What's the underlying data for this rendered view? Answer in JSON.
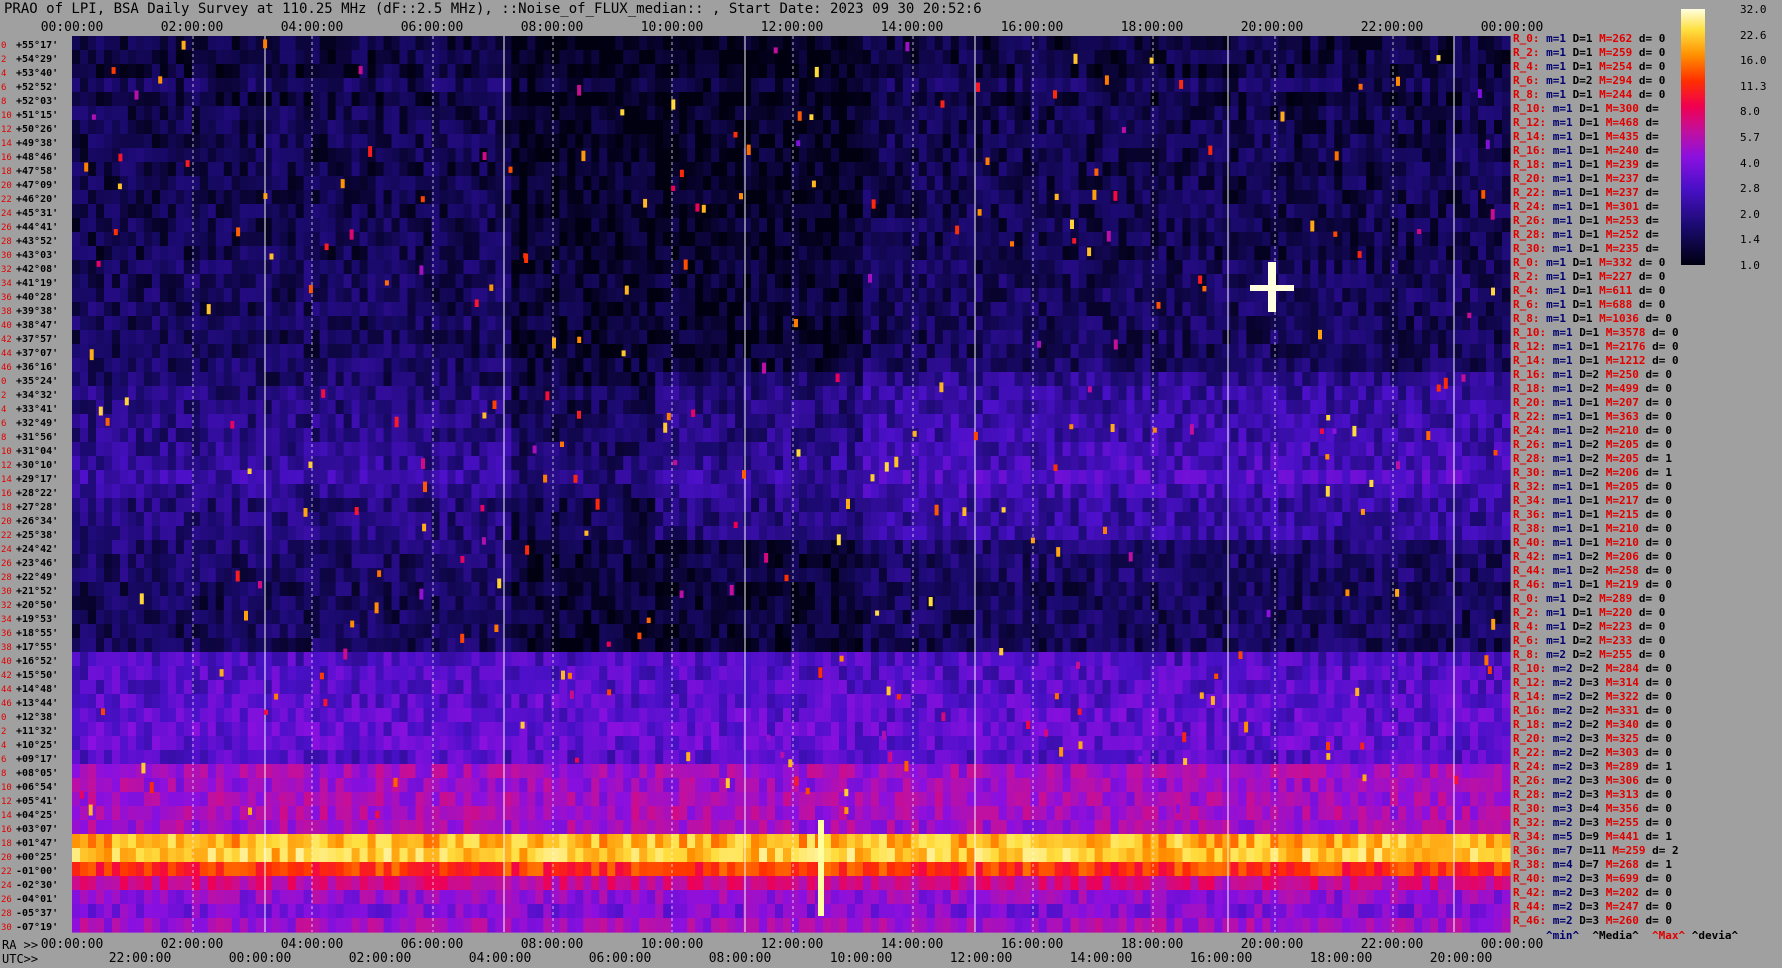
{
  "title": "PRAO of LPI, BSA Daily Survey at 110.25 MHz (dF::2.5 MHz), ::Noise_of_FLUX_median:: , Start Date: 2023 09 30 20:52:6",
  "top_axis_ticks": [
    "00:00:00",
    "02:00:00",
    "04:00:00",
    "06:00:00",
    "08:00:00",
    "10:00:00",
    "12:00:00",
    "14:00:00",
    "16:00:00",
    "18:00:00",
    "20:00:00",
    "22:00:00",
    "00:00:00"
  ],
  "bottom_axis": {
    "ra_prefix": "RA >>",
    "utc_prefix": "UTC>>",
    "ra_ticks": [
      "00:00:00",
      "02:00:00",
      "04:00:00",
      "06:00:00",
      "08:00:00",
      "10:00:00",
      "12:00:00",
      "14:00:00",
      "16:00:00",
      "18:00:00",
      "20:00:00",
      "22:00:00",
      "00:00:00"
    ],
    "utc_ticks": [
      "22:00:00",
      "00:00:00",
      "02:00:00",
      "04:00:00",
      "06:00:00",
      "08:00:00",
      "10:00:00",
      "12:00:00",
      "14:00:00",
      "16:00:00",
      "18:00:00",
      "20:00:00"
    ]
  },
  "colorbar": {
    "labels": [
      "32.0",
      "22.6",
      "16.0",
      "11.3",
      "8.0",
      "5.7",
      "4.0",
      "2.8",
      "2.0",
      "1.4",
      "1.0"
    ]
  },
  "legend": {
    "min": "^min^",
    "median": "^Media^",
    "max": "^Max^",
    "devia": "^devia^"
  },
  "stats_rows": [
    {
      "r": "R_0:",
      "m": "m=1",
      "d": "D=1",
      "n": "M=262",
      "dv": "d= 0"
    },
    {
      "r": "R_2:",
      "m": "m=1",
      "d": "D=1",
      "n": "M=259",
      "dv": "d= 0"
    },
    {
      "r": "R_4:",
      "m": "m=1",
      "d": "D=1",
      "n": "M=254",
      "dv": "d= 0"
    },
    {
      "r": "R_6:",
      "m": "m=1",
      "d": "D=2",
      "n": "M=294",
      "dv": "d= 0"
    },
    {
      "r": "R_8:",
      "m": "m=1",
      "d": "D=1",
      "n": "M=244",
      "dv": "d= 0"
    },
    {
      "r": "R_10:",
      "m": "m=1",
      "d": "D=1",
      "n": "M=300",
      "dv": "d="
    },
    {
      "r": "R_12:",
      "m": "m=1",
      "d": "D=1",
      "n": "M=468",
      "dv": "d="
    },
    {
      "r": "R_14:",
      "m": "m=1",
      "d": "D=1",
      "n": "M=435",
      "dv": "d="
    },
    {
      "r": "R_16:",
      "m": "m=1",
      "d": "D=1",
      "n": "M=240",
      "dv": "d="
    },
    {
      "r": "R_18:",
      "m": "m=1",
      "d": "D=1",
      "n": "M=239",
      "dv": "d="
    },
    {
      "r": "R_20:",
      "m": "m=1",
      "d": "D=1",
      "n": "M=237",
      "dv": "d="
    },
    {
      "r": "R_22:",
      "m": "m=1",
      "d": "D=1",
      "n": "M=237",
      "dv": "d="
    },
    {
      "r": "R_24:",
      "m": "m=1",
      "d": "D=1",
      "n": "M=301",
      "dv": "d="
    },
    {
      "r": "R_26:",
      "m": "m=1",
      "d": "D=1",
      "n": "M=253",
      "dv": "d="
    },
    {
      "r": "R_28:",
      "m": "m=1",
      "d": "D=1",
      "n": "M=252",
      "dv": "d="
    },
    {
      "r": "R_30:",
      "m": "m=1",
      "d": "D=1",
      "n": "M=235",
      "dv": "d="
    },
    {
      "r": "R_0:",
      "m": "m=1",
      "d": "D=1",
      "n": "M=332",
      "dv": "d= 0"
    },
    {
      "r": "R_2:",
      "m": "m=1",
      "d": "D=1",
      "n": "M=227",
      "dv": "d= 0"
    },
    {
      "r": "R_4:",
      "m": "m=1",
      "d": "D=1",
      "n": "M=611",
      "dv": "d= 0"
    },
    {
      "r": "R_6:",
      "m": "m=1",
      "d": "D=1",
      "n": "M=688",
      "dv": "d= 0"
    },
    {
      "r": "R_8:",
      "m": "m=1",
      "d": "D=1",
      "n": "M=1036",
      "dv": "d= 0"
    },
    {
      "r": "R_10:",
      "m": "m=1",
      "d": "D=1",
      "n": "M=3578",
      "dv": "d= 0"
    },
    {
      "r": "R_12:",
      "m": "m=1",
      "d": "D=1",
      "n": "M=2176",
      "dv": "d= 0"
    },
    {
      "r": "R_14:",
      "m": "m=1",
      "d": "D=1",
      "n": "M=1212",
      "dv": "d= 0"
    },
    {
      "r": "R_16:",
      "m": "m=1",
      "d": "D=2",
      "n": "M=250",
      "dv": "d= 0"
    },
    {
      "r": "R_18:",
      "m": "m=1",
      "d": "D=2",
      "n": "M=499",
      "dv": "d= 0"
    },
    {
      "r": "R_20:",
      "m": "m=1",
      "d": "D=1",
      "n": "M=207",
      "dv": "d= 0"
    },
    {
      "r": "R_22:",
      "m": "m=1",
      "d": "D=1",
      "n": "M=363",
      "dv": "d= 0"
    },
    {
      "r": "R_24:",
      "m": "m=1",
      "d": "D=2",
      "n": "M=210",
      "dv": "d= 0"
    },
    {
      "r": "R_26:",
      "m": "m=1",
      "d": "D=2",
      "n": "M=205",
      "dv": "d= 0"
    },
    {
      "r": "R_28:",
      "m": "m=1",
      "d": "D=2",
      "n": "M=205",
      "dv": "d= 1"
    },
    {
      "r": "R_30:",
      "m": "m=1",
      "d": "D=2",
      "n": "M=206",
      "dv": "d= 1"
    },
    {
      "r": "R_32:",
      "m": "m=1",
      "d": "D=1",
      "n": "M=205",
      "dv": "d= 0"
    },
    {
      "r": "R_34:",
      "m": "m=1",
      "d": "D=1",
      "n": "M=217",
      "dv": "d= 0"
    },
    {
      "r": "R_36:",
      "m": "m=1",
      "d": "D=1",
      "n": "M=215",
      "dv": "d= 0"
    },
    {
      "r": "R_38:",
      "m": "m=1",
      "d": "D=1",
      "n": "M=210",
      "dv": "d= 0"
    },
    {
      "r": "R_40:",
      "m": "m=1",
      "d": "D=1",
      "n": "M=210",
      "dv": "d= 0"
    },
    {
      "r": "R_42:",
      "m": "m=1",
      "d": "D=2",
      "n": "M=206",
      "dv": "d= 0"
    },
    {
      "r": "R_44:",
      "m": "m=1",
      "d": "D=2",
      "n": "M=258",
      "dv": "d= 0"
    },
    {
      "r": "R_46:",
      "m": "m=1",
      "d": "D=1",
      "n": "M=219",
      "dv": "d= 0"
    },
    {
      "r": "R_0:",
      "m": "m=1",
      "d": "D=2",
      "n": "M=289",
      "dv": "d= 0"
    },
    {
      "r": "R_2:",
      "m": "m=1",
      "d": "D=1",
      "n": "M=220",
      "dv": "d= 0"
    },
    {
      "r": "R_4:",
      "m": "m=1",
      "d": "D=2",
      "n": "M=223",
      "dv": "d= 0"
    },
    {
      "r": "R_6:",
      "m": "m=1",
      "d": "D=2",
      "n": "M=233",
      "dv": "d= 0"
    },
    {
      "r": "R_8:",
      "m": "m=2",
      "d": "D=2",
      "n": "M=255",
      "dv": "d= 0"
    },
    {
      "r": "R_10:",
      "m": "m=2",
      "d": "D=2",
      "n": "M=284",
      "dv": "d= 0"
    },
    {
      "r": "R_12:",
      "m": "m=2",
      "d": "D=3",
      "n": "M=314",
      "dv": "d= 0"
    },
    {
      "r": "R_14:",
      "m": "m=2",
      "d": "D=2",
      "n": "M=322",
      "dv": "d= 0"
    },
    {
      "r": "R_16:",
      "m": "m=2",
      "d": "D=2",
      "n": "M=331",
      "dv": "d= 0"
    },
    {
      "r": "R_18:",
      "m": "m=2",
      "d": "D=2",
      "n": "M=340",
      "dv": "d= 0"
    },
    {
      "r": "R_20:",
      "m": "m=2",
      "d": "D=3",
      "n": "M=325",
      "dv": "d= 0"
    },
    {
      "r": "R_22:",
      "m": "m=2",
      "d": "D=2",
      "n": "M=303",
      "dv": "d= 0"
    },
    {
      "r": "R_24:",
      "m": "m=2",
      "d": "D=3",
      "n": "M=289",
      "dv": "d= 1"
    },
    {
      "r": "R_26:",
      "m": "m=2",
      "d": "D=3",
      "n": "M=306",
      "dv": "d= 0"
    },
    {
      "r": "R_28:",
      "m": "m=2",
      "d": "D=3",
      "n": "M=313",
      "dv": "d= 0"
    },
    {
      "r": "R_30:",
      "m": "m=3",
      "d": "D=4",
      "n": "M=356",
      "dv": "d= 0"
    },
    {
      "r": "R_32:",
      "m": "m=2",
      "d": "D=3",
      "n": "M=255",
      "dv": "d= 0"
    },
    {
      "r": "R_34:",
      "m": "m=5",
      "d": "D=9",
      "n": "M=441",
      "dv": "d= 1"
    },
    {
      "r": "R_36:",
      "m": "m=7",
      "d": "D=11",
      "n": "M=259",
      "dv": "d= 2"
    },
    {
      "r": "R_38:",
      "m": "m=4",
      "d": "D=7",
      "n": "M=268",
      "dv": "d= 1"
    },
    {
      "r": "R_40:",
      "m": "m=2",
      "d": "D=3",
      "n": "M=699",
      "dv": "d= 0"
    },
    {
      "r": "R_42:",
      "m": "m=2",
      "d": "D=3",
      "n": "M=202",
      "dv": "d= 0"
    },
    {
      "r": "R_44:",
      "m": "m=2",
      "d": "D=3",
      "n": "M=247",
      "dv": "d= 0"
    },
    {
      "r": "R_46:",
      "m": "m=2",
      "d": "D=3",
      "n": "M=260",
      "dv": "d= 0"
    }
  ],
  "dec_labels": [
    "+55°17'",
    "+54°29'",
    "+53°40'",
    "+52°52'",
    "+52°03'",
    "+51°15'",
    "+50°26'",
    "+49°38'",
    "+48°46'",
    "+47°58'",
    "+47°09'",
    "+46°20'",
    "+45°31'",
    "+44°41'",
    "+43°52'",
    "+43°03'",
    "+42°08'",
    "+41°19'",
    "+40°28'",
    "+39°38'",
    "+38°47'",
    "+37°57'",
    "+37°07'",
    "+36°16'",
    "+35°24'",
    "+34°32'",
    "+33°41'",
    "+32°49'",
    "+31°56'",
    "+31°04'",
    "+30°10'",
    "+29°17'",
    "+28°22'",
    "+27°28'",
    "+26°34'",
    "+25°38'",
    "+24°42'",
    "+23°46'",
    "+22°49'",
    "+21°52'",
    "+20°50'",
    "+19°53'",
    "+18°55'",
    "+17°55'",
    "+16°52'",
    "+15°50'",
    "+14°48'",
    "+13°44'",
    "+12°38'",
    "+11°32'",
    "+10°25'",
    "+09°17'",
    "+08°05'",
    "+06°54'",
    "+05°41'",
    "+04°25'",
    "+03°07'",
    "+01°47'",
    "+00°25'",
    "-01°00'",
    "-02°30'",
    "-04°01'",
    "-05°37'",
    "-07°19'"
  ],
  "chart_data": {
    "type": "heatmap",
    "title": "PRAO of LPI, BSA Daily Survey at 110.25 MHz (dF::2.5 MHz), ::Noise_of_FLUX_median:: , Start Date: 2023 09 30 20:52:6",
    "x_axis_ra": [
      "00:00:00",
      "02:00:00",
      "04:00:00",
      "06:00:00",
      "08:00:00",
      "10:00:00",
      "12:00:00",
      "14:00:00",
      "16:00:00",
      "18:00:00",
      "20:00:00",
      "22:00:00",
      "00:00:00"
    ],
    "x_axis_utc": [
      "22:00:00",
      "00:00:00",
      "02:00:00",
      "04:00:00",
      "06:00:00",
      "08:00:00",
      "10:00:00",
      "12:00:00",
      "14:00:00",
      "16:00:00",
      "18:00:00",
      "20:00:00"
    ],
    "colorscale": [
      "1.0",
      "1.4",
      "2.0",
      "2.8",
      "4.0",
      "5.7",
      "8.0",
      "11.3",
      "16.0",
      "22.6",
      "32.0"
    ],
    "band_levels": [
      1.3,
      1.3,
      1.3,
      1.5,
      1.3,
      1.4,
      1.4,
      1.4,
      1.4,
      1.4,
      1.4,
      1.4,
      1.4,
      1.4,
      1.4,
      1.4,
      1.5,
      1.5,
      1.5,
      1.5,
      1.5,
      1.5,
      1.5,
      1.6,
      1.6,
      1.8,
      1.8,
      1.9,
      1.9,
      2.0,
      2.1,
      2.3,
      2.0,
      1.8,
      1.8,
      1.8,
      1.7,
      1.6,
      1.6,
      1.5,
      1.5,
      1.5,
      1.5,
      1.5,
      2.8,
      2.9,
      3.0,
      3.1,
      3.2,
      3.3,
      3.3,
      3.0,
      5.0,
      4.8,
      5.0,
      5.2,
      5.0,
      20.0,
      22.0,
      12.0,
      6.5,
      4.5,
      4.0,
      5.0
    ]
  }
}
